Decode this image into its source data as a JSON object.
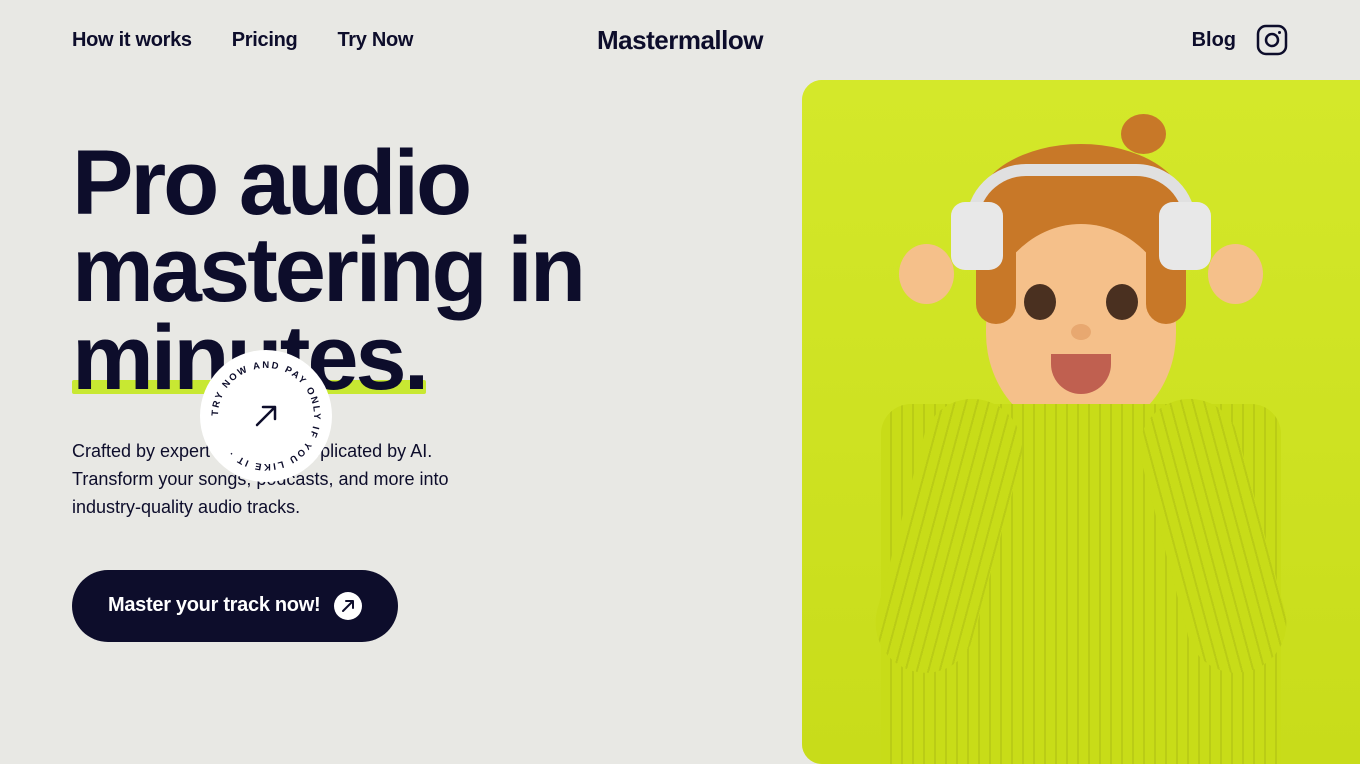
{
  "nav": {
    "links": [
      {
        "id": "how-it-works",
        "label": "How it works"
      },
      {
        "id": "pricing",
        "label": "Pricing"
      },
      {
        "id": "try-now",
        "label": "Try Now"
      }
    ],
    "brand": "Mastermallow",
    "blog_label": "Blog"
  },
  "hero": {
    "title_line1": "Pro audio",
    "title_line2": "mastering in",
    "title_line3": "minutes.",
    "subtitle": "Crafted by expert engineers, replicated by AI. Transform your songs, podcasts, and more into industry-quality audio tracks.",
    "cta_label": "Master your track now!",
    "badge_text": "TRY NOW AND PAY ONLY IF YOU LIKE IT ·"
  },
  "colors": {
    "dark": "#0d0d2b",
    "accent": "#d4e82a",
    "bg": "#e8e8e4",
    "white": "#ffffff"
  }
}
